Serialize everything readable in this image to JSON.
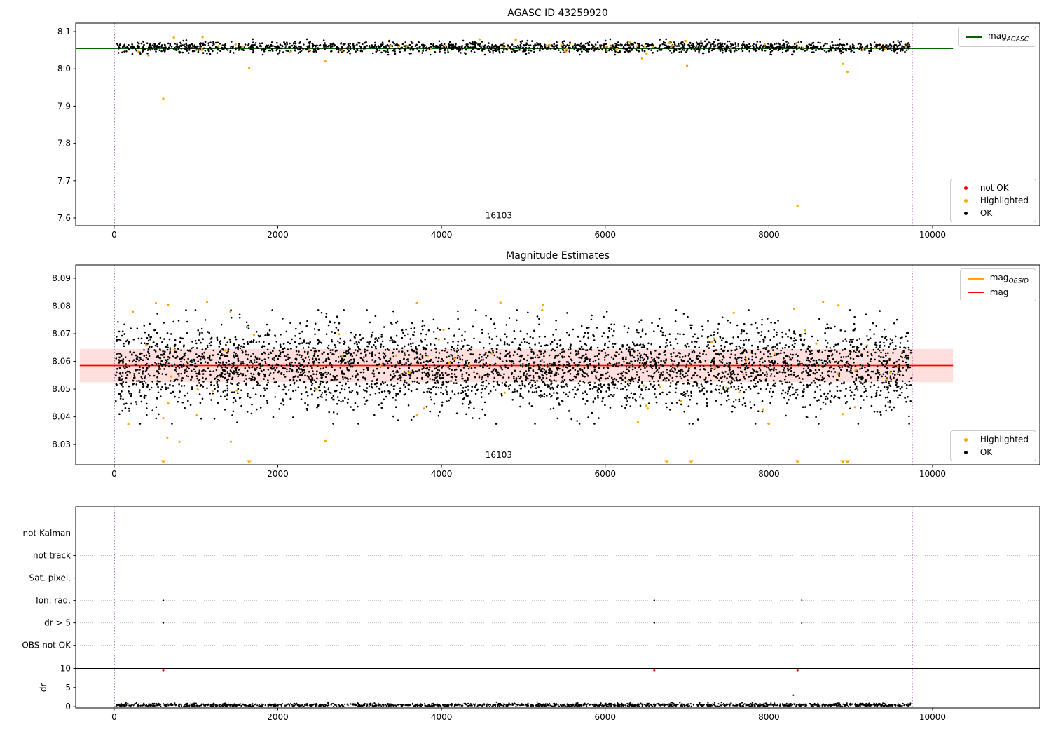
{
  "chart_data": [
    {
      "id": "agasc-mag",
      "type": "scatter",
      "title": "AGASC ID 43259920",
      "xlim": [
        -470,
        11310
      ],
      "ylim": [
        7.5793,
        8.1226
      ],
      "xticks": [
        {
          "v": 0,
          "label": "0"
        },
        {
          "v": 2000,
          "label": "2000"
        },
        {
          "v": 4000,
          "label": "4000"
        },
        {
          "v": 6000,
          "label": "6000"
        },
        {
          "v": 8000,
          "label": "8000"
        },
        {
          "v": 10000,
          "label": "10000"
        }
      ],
      "yticks": [
        {
          "v": 7.6,
          "label": "7.6"
        },
        {
          "v": 7.7,
          "label": "7.7"
        },
        {
          "v": 7.8,
          "label": "7.8"
        },
        {
          "v": 7.9,
          "label": "7.9"
        },
        {
          "v": 8.0,
          "label": "8.0"
        },
        {
          "v": 8.1,
          "label": "8.1"
        }
      ],
      "vlines": {
        "color": "#800080",
        "xs": [
          0,
          9750
        ]
      },
      "hlines": [
        {
          "y": 8.0545,
          "x0": -470,
          "x1": 10250,
          "color": "#006400",
          "width": 1.6,
          "name": "mag-agasc-line"
        }
      ],
      "annotation": {
        "text": "16103",
        "x": 4700,
        "y": 7.607
      },
      "series": [
        {
          "name": "OK",
          "color": "#000000",
          "r": 1.3,
          "gen": {
            "seed": 101,
            "n": 1700,
            "x0": 20,
            "x1": 9740,
            "mean": 8.058,
            "std": 0.0075,
            "clip": [
              8.038,
              8.0795
            ]
          }
        },
        {
          "name": "Highlighted",
          "color": "#FFA500",
          "r": 1.6,
          "gen": {
            "seed": 202,
            "n": 46,
            "x0": 30,
            "x1": 9700,
            "mean": 8.06,
            "std": 0.009,
            "clip": [
              8.028,
              8.0865
            ]
          },
          "points": [
            [
              600,
              7.92
            ],
            [
              8350,
              7.632
            ],
            [
              1650,
              8.003
            ],
            [
              2580,
              8.02
            ],
            [
              7000,
              8.008
            ],
            [
              8900,
              8.013
            ],
            [
              8960,
              7.992
            ],
            [
              6450,
              8.028
            ],
            [
              420,
              8.036
            ],
            [
              1080,
              8.085
            ],
            [
              730,
              8.084
            ]
          ]
        },
        {
          "name": "not OK",
          "color": "#FF0000",
          "r": 1.6,
          "points": []
        }
      ],
      "legends": [
        {
          "loc": "top-right",
          "items": [
            {
              "swatch": "line",
              "color": "#006400",
              "label": "mag",
              "sub": "AGASC"
            }
          ]
        },
        {
          "loc": "bottom-right",
          "items": [
            {
              "swatch": "dot",
              "color": "#FF0000",
              "label": "not OK"
            },
            {
              "swatch": "dot",
              "color": "#FFA500",
              "label": "Highlighted"
            },
            {
              "swatch": "dot",
              "color": "#000000",
              "label": "OK"
            }
          ]
        }
      ]
    },
    {
      "id": "mag-estimates",
      "type": "scatter",
      "title": "Magnitude Estimates",
      "xlim": [
        -470,
        11310
      ],
      "ylim": [
        8.0227,
        8.0948
      ],
      "xticks": [
        {
          "v": 0,
          "label": "0"
        },
        {
          "v": 2000,
          "label": "2000"
        },
        {
          "v": 4000,
          "label": "4000"
        },
        {
          "v": 6000,
          "label": "6000"
        },
        {
          "v": 8000,
          "label": "8000"
        },
        {
          "v": 10000,
          "label": "10000"
        }
      ],
      "yticks": [
        {
          "v": 8.03,
          "label": "8.03"
        },
        {
          "v": 8.04,
          "label": "8.04"
        },
        {
          "v": 8.05,
          "label": "8.05"
        },
        {
          "v": 8.06,
          "label": "8.06"
        },
        {
          "v": 8.07,
          "label": "8.07"
        },
        {
          "v": 8.08,
          "label": "8.08"
        },
        {
          "v": 8.09,
          "label": "8.09"
        }
      ],
      "vlines": {
        "color": "#800080",
        "xs": [
          0,
          9750
        ]
      },
      "band": {
        "y0": 8.0525,
        "y1": 8.0645,
        "x0": -420,
        "x1": 10250,
        "color": "rgba(255,0,0,0.13)"
      },
      "hlines": [
        {
          "y": 8.0585,
          "x0": -420,
          "x1": 10250,
          "color": "#FF0000",
          "width": 1.8,
          "name": "mag-line"
        }
      ],
      "annotation": {
        "text": "16103",
        "x": 4700,
        "y": 8.0262
      },
      "triangles": {
        "color": "#FFA500",
        "y": 8.0238,
        "xs": [
          600,
          1650,
          6750,
          7050,
          8350,
          8900,
          8960
        ]
      },
      "series": [
        {
          "name": "OK",
          "color": "#000000",
          "r": 1.3,
          "gen": {
            "seed": 303,
            "n": 4200,
            "x0": 20,
            "x1": 9740,
            "mean": 8.058,
            "std": 0.0075,
            "clip": [
              8.0375,
              8.0785
            ]
          }
        },
        {
          "name": "Highlighted",
          "color": "#FFA500",
          "r": 1.6,
          "gen": {
            "seed": 404,
            "n": 55,
            "x0": 30,
            "x1": 9700,
            "mean": 8.059,
            "std": 0.011,
            "clip": [
              8.031,
              8.0815
            ]
          },
          "points": [
            [
              600,
              8.0395
            ],
            [
              650,
              8.0325
            ],
            [
              2580,
              8.0312
            ],
            [
              1010,
              8.0405
            ],
            [
              3700,
              8.0405
            ],
            [
              6400,
              8.038
            ],
            [
              6520,
              8.043
            ],
            [
              8000,
              8.0375
            ],
            [
              8900,
              8.041
            ],
            [
              9050,
              8.0435
            ],
            [
              3700,
              8.081
            ],
            [
              4720,
              8.0812
            ],
            [
              510,
              8.081
            ],
            [
              660,
              8.0805
            ],
            [
              230,
              8.078
            ],
            [
              1420,
              8.078
            ],
            [
              5230,
              8.0785
            ],
            [
              8850,
              8.0802
            ],
            [
              8310,
              8.079
            ]
          ]
        }
      ],
      "legends": [
        {
          "loc": "top-right",
          "items": [
            {
              "swatch": "thickline",
              "color": "#FFA500",
              "label": "mag",
              "sub": "OBSID"
            },
            {
              "swatch": "line",
              "color": "#FF0000",
              "label": "mag",
              "sub": ""
            }
          ]
        },
        {
          "loc": "bottom-right",
          "items": [
            {
              "swatch": "dot",
              "color": "#FFA500",
              "label": "Highlighted"
            },
            {
              "swatch": "dot",
              "color": "#000000",
              "label": "OK"
            }
          ]
        }
      ]
    },
    {
      "id": "flags",
      "type": "scatter",
      "title": "",
      "xlim": [
        -470,
        11310
      ],
      "ylim": [
        -0.35,
        52.2
      ],
      "xticks": [
        {
          "v": 0,
          "label": "0"
        },
        {
          "v": 2000,
          "label": "2000"
        },
        {
          "v": 4000,
          "label": "4000"
        },
        {
          "v": 6000,
          "label": "6000"
        },
        {
          "v": 8000,
          "label": "8000"
        },
        {
          "v": 10000,
          "label": "10000"
        }
      ],
      "yticks": [
        {
          "v": 45.33,
          "label": "not Kalman",
          "grid": true
        },
        {
          "v": 39.47,
          "label": "not track",
          "grid": true
        },
        {
          "v": 33.6,
          "label": "Sat. pixel.",
          "grid": true
        },
        {
          "v": 27.73,
          "label": "Ion. rad.",
          "grid": true
        },
        {
          "v": 21.87,
          "label": "dr > 5",
          "grid": true
        },
        {
          "v": 16.0,
          "label": "OBS not OK",
          "grid": true
        },
        {
          "v": 10,
          "label": "10"
        },
        {
          "v": 5,
          "label": "5"
        },
        {
          "v": 0,
          "label": "0"
        }
      ],
      "ylabel": {
        "text": "dr",
        "v": 5
      },
      "vlines": {
        "color": "#800080",
        "xs": [
          0,
          9750
        ]
      },
      "hlines": [
        {
          "y": 10,
          "x0": -470,
          "x1": 11310,
          "color": "#000000",
          "width": 1,
          "name": "dr-limit-line"
        }
      ],
      "series": [
        {
          "name": "dr OK",
          "color": "#000000",
          "r": 1.1,
          "gen": {
            "seed": 505,
            "n": 1500,
            "x0": 20,
            "x1": 9740,
            "mean": 0.4,
            "std": 0.22,
            "clip": [
              0.04,
              1.8
            ]
          },
          "points": [
            [
              8300,
              3.0
            ]
          ]
        },
        {
          "name": "dr not OK",
          "color": "#FF0000",
          "r": 1.5,
          "points": [
            [
              600,
              9.5
            ],
            [
              6600,
              9.5
            ],
            [
              8350,
              9.5
            ]
          ]
        },
        {
          "name": "Ion rad flag",
          "color": "#000000",
          "r": 1.2,
          "points": [
            [
              600,
              27.73
            ],
            [
              6600,
              27.73
            ],
            [
              8400,
              27.73
            ]
          ]
        },
        {
          "name": "dr gt 5 flag",
          "color": "#000000",
          "r": 1.2,
          "points": [
            [
              600,
              21.87
            ],
            [
              6600,
              21.87
            ],
            [
              8400,
              21.87
            ]
          ]
        }
      ],
      "legends": []
    }
  ]
}
